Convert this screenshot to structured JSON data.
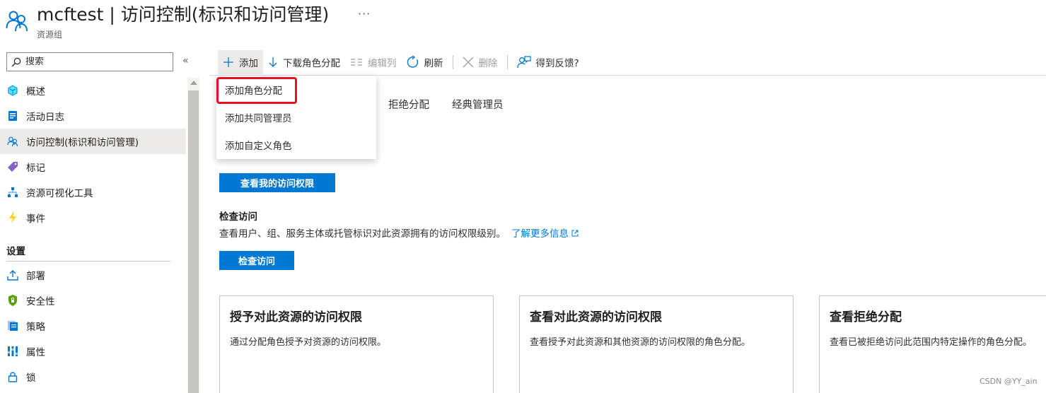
{
  "header": {
    "title": "mcftest | 访问控制(标识和访问管理)",
    "subtitle": "资源组",
    "more": "···"
  },
  "sidebar": {
    "search_placeholder": "搜索",
    "collapse": "«",
    "items": [
      {
        "label": "概述",
        "icon": "overview-icon"
      },
      {
        "label": "活动日志",
        "icon": "activity-log-icon"
      },
      {
        "label": "访问控制(标识和访问管理)",
        "icon": "people-icon"
      },
      {
        "label": "标记",
        "icon": "tag-icon"
      },
      {
        "label": "资源可视化工具",
        "icon": "hierarchy-icon"
      },
      {
        "label": "事件",
        "icon": "lightning-icon"
      }
    ],
    "section_title": "设置",
    "settings_items": [
      {
        "label": "部署",
        "icon": "upload-icon"
      },
      {
        "label": "安全性",
        "icon": "shield-icon"
      },
      {
        "label": "策略",
        "icon": "policy-icon"
      },
      {
        "label": "属性",
        "icon": "properties-icon"
      },
      {
        "label": "锁",
        "icon": "lock-icon"
      }
    ]
  },
  "toolbar": {
    "add": "添加",
    "download": "下载角色分配",
    "edit_columns": "编辑列",
    "refresh": "刷新",
    "delete": "删除",
    "feedback": "得到反馈?"
  },
  "dropdown": {
    "items": [
      "添加角色分配",
      "添加共同管理员",
      "添加自定义角色"
    ]
  },
  "tabs": [
    "拒绝分配",
    "经典管理员"
  ],
  "main": {
    "view_my_access_button": "查看我的访问权限",
    "check_access_title": "检查访问",
    "check_access_desc": "查看用户、组、服务主体或托管标识对此资源拥有的访问权限级别。",
    "learn_more": "了解更多信息",
    "check_access_button": "检查访问"
  },
  "cards": [
    {
      "title": "授予对此资源的访问权限",
      "desc": "通过分配角色授予对资源的访问权限。"
    },
    {
      "title": "查看对此资源的访问权限",
      "desc": "查看授予对此资源和其他资源的访问权限的角色分配。"
    },
    {
      "title": "查看拒绝分配",
      "desc": "查看已被拒绝访问此范围内特定操作的角色分配。"
    }
  ],
  "watermark": "CSDN @YY_ain",
  "colors": {
    "accent": "#0078d4",
    "highlight_border": "#e81123"
  }
}
